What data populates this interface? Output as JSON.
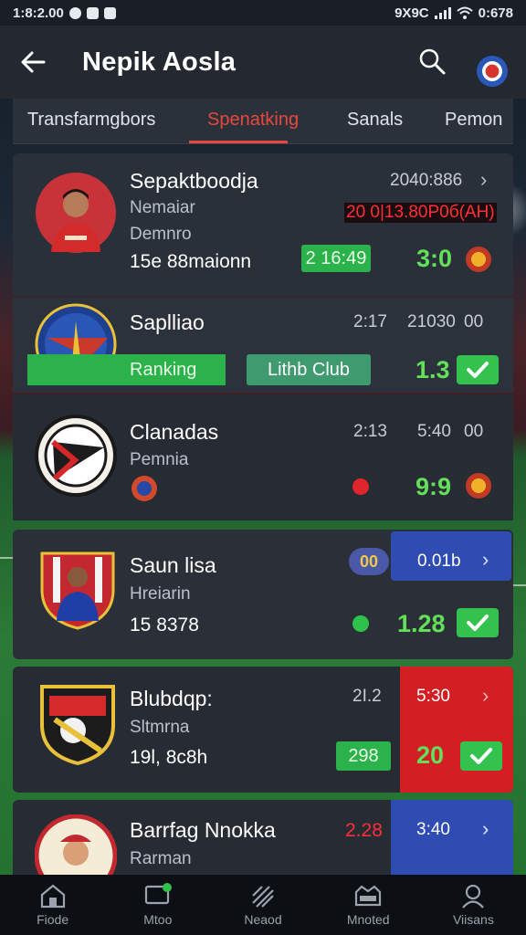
{
  "status_bar": {
    "time": "1:8:2.00",
    "right_text": "9X9C",
    "battery": "0:678"
  },
  "header": {
    "title": "Nepik Aosla"
  },
  "tabs": [
    {
      "label": "Transfarmgbors",
      "active": false
    },
    {
      "label": "Spenatking",
      "active": true
    },
    {
      "label": "Sanals",
      "active": false
    },
    {
      "label": "Pemon",
      "active": false
    }
  ],
  "cards": [
    {
      "name": "Sepaktboodja",
      "line1": "Nemaiar",
      "line2": "Demnro",
      "stat": "15e 88maionn",
      "time": "2040:886",
      "date_badge": "20 0|13.80P0б(AH)",
      "pill": "2 16:49",
      "odd": "3:0"
    },
    {
      "name": "Saplliao",
      "time_a": "2:17",
      "time_b": "21030",
      "time_c": "00",
      "ranking_label": "Ranking",
      "club_label": "Lithb Club",
      "odd": "1.3"
    },
    {
      "name": "Clanadas",
      "line1": "Pemnia",
      "time_a": "2:13",
      "time_b": "5:40",
      "time_c": "00",
      "odd": "9:9"
    },
    {
      "name": "Saun lisa",
      "line1": "Hreiarin",
      "stat": "15 8378",
      "chip": "00",
      "box_value": "0.01b",
      "odd": "1.28"
    },
    {
      "name": "Blubdqp:",
      "line1": "Sltmrna",
      "stat": "19l, 8c8h",
      "time_a": "2I.2",
      "pill": "298",
      "box_value": "5:30",
      "odd": "20"
    },
    {
      "name": "Barrfag Nnokka",
      "line1": "Rarman",
      "time_a": "2.28",
      "box_value": "3:40"
    }
  ],
  "bottom_nav": [
    {
      "label": "Fiode",
      "icon": "home-icon"
    },
    {
      "label": "Mtoo",
      "icon": "chat-icon"
    },
    {
      "label": "Neaod",
      "icon": "news-icon"
    },
    {
      "label": "Mnoted",
      "icon": "stadium-icon"
    },
    {
      "label": "Viisans",
      "icon": "profile-icon"
    }
  ],
  "colors": {
    "accent": "#e8473c",
    "odds_green": "#62e05a",
    "highlight_blue": "#2f4cb2",
    "highlight_red": "#d31f24"
  }
}
